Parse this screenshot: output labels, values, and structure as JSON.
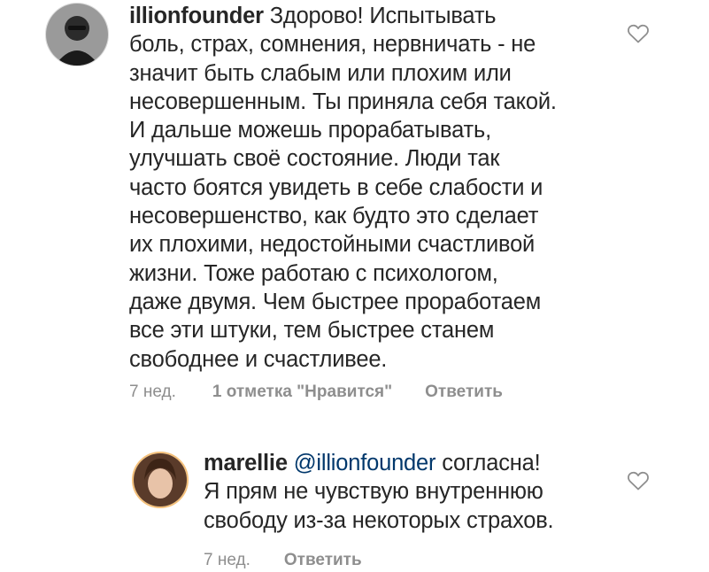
{
  "comments": [
    {
      "username": "illionfounder",
      "text": "Здорово! Испытывать\nболь, страх, сомнения, нервничать - не\nзначит быть слабым или плохим или\nнесовершенным. Ты приняла себя такой.\nИ дальше можешь прорабатывать,\nулучшать своё состояние. Люди так\nчасто боятся увидеть в себе слабости и\nнесовершенство, как будто это сделает\nих плохими, недостойными счастливой\nжизни. Тоже работаю с психологом,\nдаже двумя. Чем быстрее проработаем\nвсе эти штуки, тем быстрее станем\nсвободнее и  счастливее.",
      "age": "7 нед.",
      "likes": "1 отметка \"Нравится\"",
      "reply": "Ответить",
      "like_icon": "heart-outline-icon"
    },
    {
      "username": "marellie",
      "mention": "@illionfounder",
      "text": " согласна!\nЯ прям не чувствую внутреннюю\nсвободу из-за некоторых страхов.",
      "age": "7 нед.",
      "reply": "Ответить",
      "like_icon": "heart-outline-icon"
    }
  ],
  "colors": {
    "text": "#262626",
    "meta": "#8e8e8e",
    "mention": "#00376b",
    "heart": "#8e8e8e"
  }
}
